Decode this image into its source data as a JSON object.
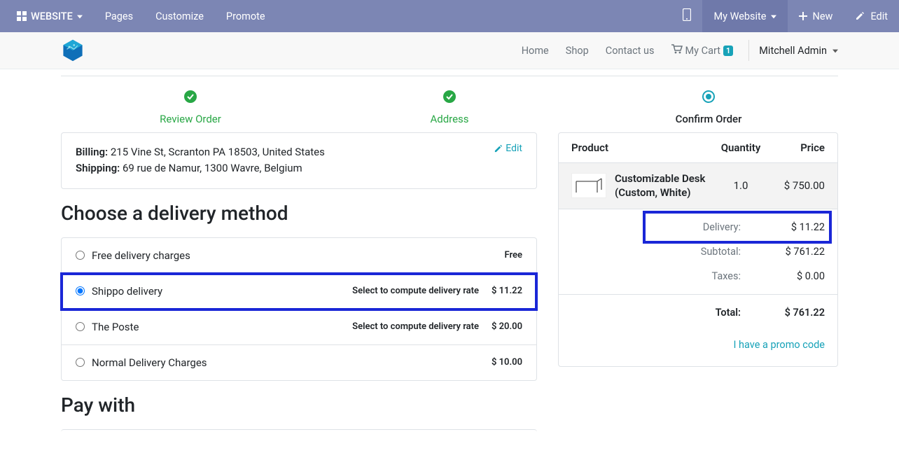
{
  "topbar": {
    "website_label": "WEBSITE",
    "pages_label": "Pages",
    "customize_label": "Customize",
    "promote_label": "Promote",
    "mywebsite_label": "My Website",
    "new_label": "New",
    "edit_label": "Edit"
  },
  "nav": {
    "home": "Home",
    "shop": "Shop",
    "contact": "Contact us",
    "cart_label": "My Cart",
    "cart_count": "1",
    "user_name": "Mitchell Admin"
  },
  "wizard": {
    "step1": "Review Order",
    "step2": "Address",
    "step3": "Confirm Order"
  },
  "address": {
    "billing_label": "Billing:",
    "billing_value": "215 Vine St, Scranton PA 18503, United States",
    "shipping_label": "Shipping:",
    "shipping_value": "69 rue de Namur, 1300 Wavre, Belgium",
    "edit_label": "Edit"
  },
  "delivery": {
    "title": "Choose a delivery method",
    "compute_hint": "Select to compute delivery rate",
    "options": [
      {
        "name": "Free delivery charges",
        "price": "Free",
        "hint": false,
        "selected": false
      },
      {
        "name": "Shippo delivery",
        "price": "$ 11.22",
        "hint": true,
        "selected": true,
        "highlight": true
      },
      {
        "name": "The Poste",
        "price": "$ 20.00",
        "hint": true,
        "selected": false
      },
      {
        "name": "Normal Delivery Charges",
        "price": "$ 10.00",
        "hint": false,
        "selected": false
      }
    ]
  },
  "pay": {
    "title": "Pay with"
  },
  "summary": {
    "headers": {
      "product": "Product",
      "qty": "Quantity",
      "price": "Price"
    },
    "item": {
      "name": "Customizable Desk (Custom, White)",
      "qty": "1.0",
      "price": "$ 750.00"
    },
    "delivery_label": "Delivery:",
    "delivery_value": "$ 11.22",
    "subtotal_label": "Subtotal:",
    "subtotal_value": "$ 761.22",
    "taxes_label": "Taxes:",
    "taxes_value": "$ 0.00",
    "total_label": "Total:",
    "total_value": "$ 761.22",
    "promo_label": "I have a promo code"
  }
}
